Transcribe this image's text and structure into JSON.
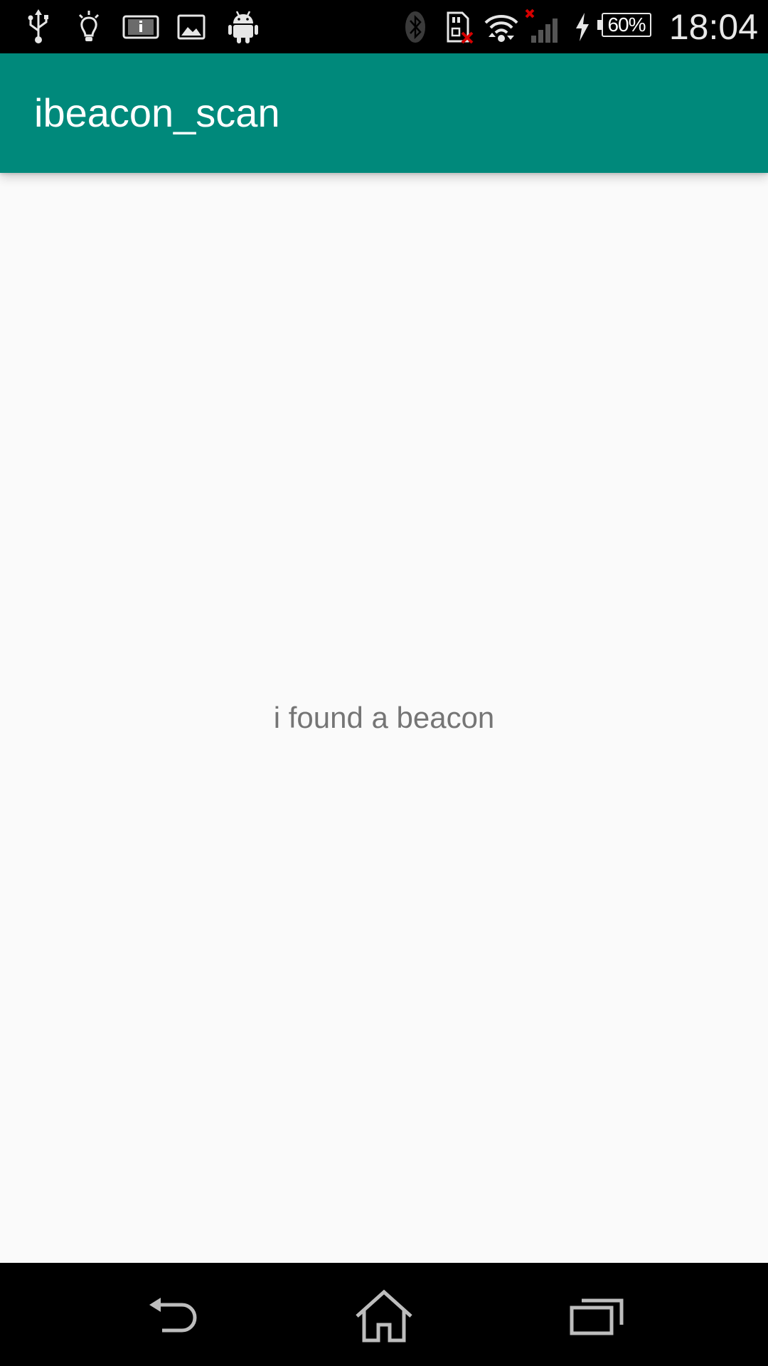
{
  "status_bar": {
    "icons": [
      "usb-icon",
      "lightbulb-icon",
      "info-card-icon",
      "image-icon",
      "android-icon",
      "bluetooth-icon",
      "sd-card-error-icon",
      "wifi-icon",
      "no-signal-icon",
      "charging-icon",
      "battery-icon"
    ],
    "battery_percent": "60%",
    "time": "18:04"
  },
  "app_bar": {
    "title": "ibeacon_scan",
    "color": "#00897b"
  },
  "content": {
    "message": "i found a beacon"
  },
  "nav_bar": {
    "buttons": [
      "back-icon",
      "home-icon",
      "recents-icon"
    ]
  }
}
